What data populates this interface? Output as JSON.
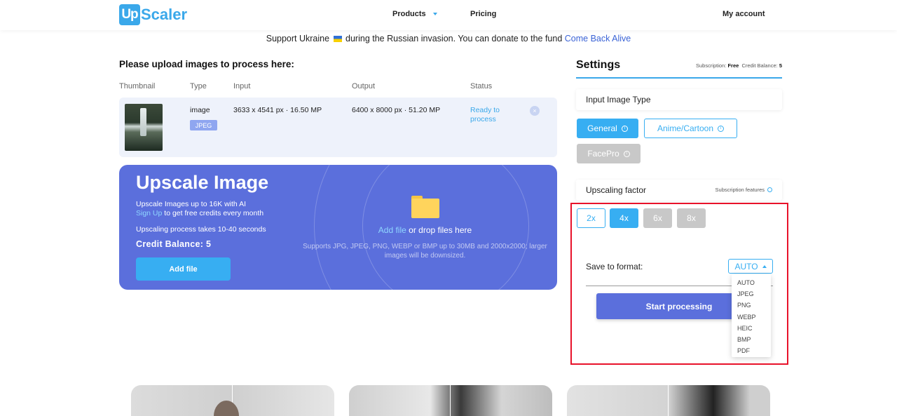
{
  "header": {
    "logo_mark": "Up",
    "logo_text": "Scaler",
    "nav": {
      "products": "Products",
      "pricing": "Pricing",
      "account": "My account"
    }
  },
  "banner": {
    "text_before": "Support Ukraine",
    "text_after": "during the Russian invasion. You can donate to the fund",
    "link": "Come Back Alive"
  },
  "upload": {
    "title": "Please upload images to process here:",
    "columns": [
      "Thumbnail",
      "Type",
      "Input",
      "Output",
      "Status"
    ],
    "row": {
      "type": "image",
      "format": "JPEG",
      "input": "3633 x 4541 px · 16.50 MP",
      "output": "6400 x 8000 px · 51.20 MP",
      "status": "Ready to process"
    }
  },
  "upscale_card": {
    "title": "Upscale Image",
    "line1": "Upscale Images up to 16K with AI",
    "signup_link": "Sign Up",
    "signup_rest": "to get free credits every month",
    "process_time": "Upscaling process takes 10-40 seconds",
    "credit_balance": "Credit Balance: 5",
    "add_file_button": "Add file",
    "drop_link": "Add file",
    "drop_rest": "or drop files here",
    "supports": "Supports JPG, JPEG, PNG, WEBP or BMP up to 30MB and 2000x2000; larger images will be downsized."
  },
  "settings": {
    "title": "Settings",
    "subscription_label": "Subscription:",
    "subscription_value": "Free",
    "credit_label": "Credit Balance:",
    "credit_value": "5",
    "input_type_label": "Input Image Type",
    "types": {
      "general": "General",
      "anime": "Anime/Cartoon",
      "face": "FacePro"
    },
    "factor_label": "Upscaling factor",
    "subscription_features": "Subscription features",
    "factors": {
      "f2": "2x",
      "f4": "4x",
      "f6": "6x",
      "f8": "8x"
    },
    "selected_factor": "4x",
    "format_label": "Save to format:",
    "format_selected": "AUTO",
    "format_options": [
      "AUTO",
      "JPEG",
      "PNG",
      "WEBP",
      "HEIC",
      "BMP",
      "PDF"
    ],
    "start_button": "Start processing"
  },
  "colors": {
    "accent": "#37aef2",
    "card": "#5b6fdc",
    "highlight": "#e8122a"
  }
}
